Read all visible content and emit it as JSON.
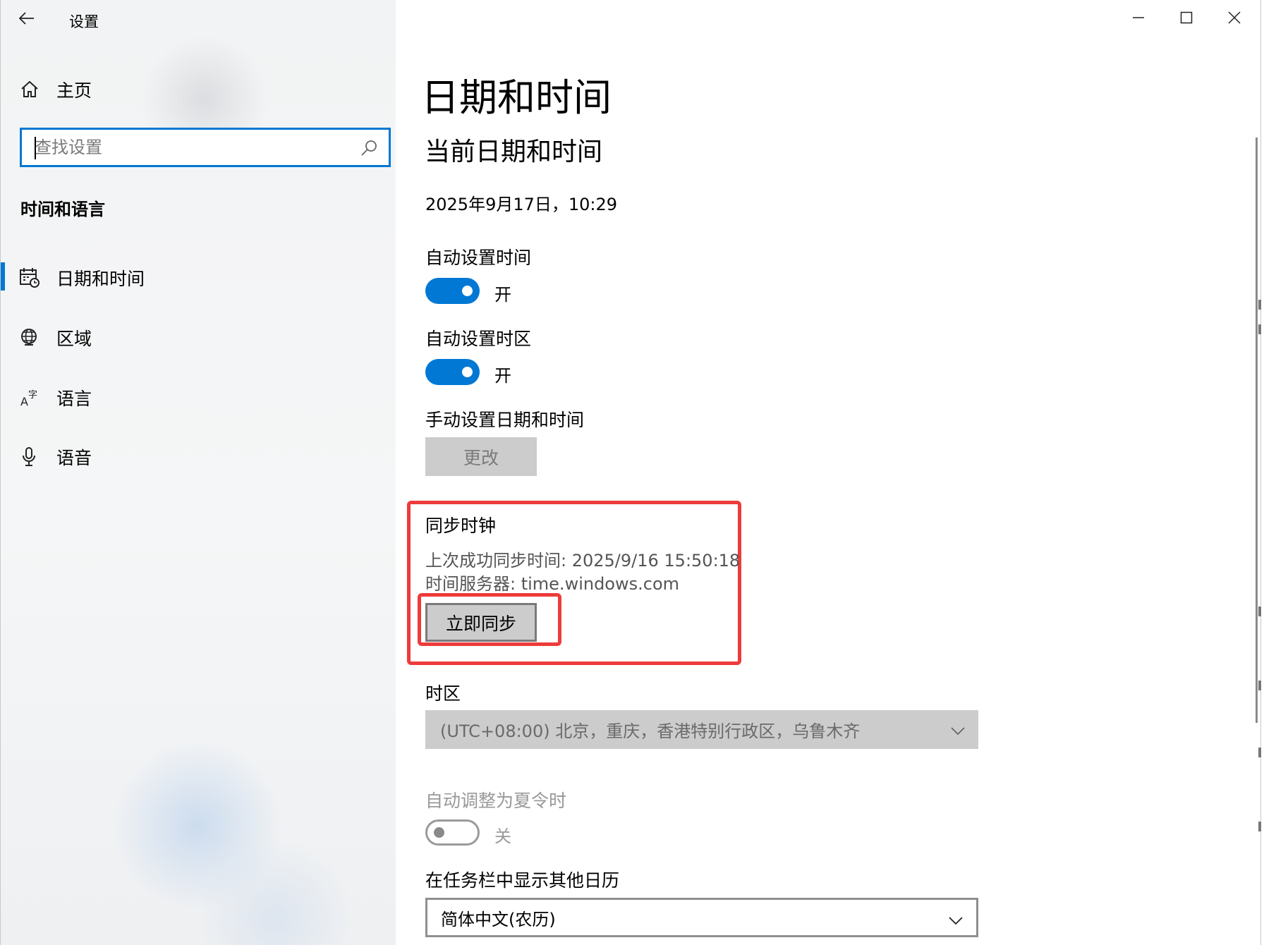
{
  "window": {
    "title": "设置",
    "controls": {
      "minimize_icon": "minimize-icon",
      "maximize_icon": "maximize-icon",
      "close_icon": "close-icon"
    }
  },
  "sidebar": {
    "home_label": "主页",
    "search": {
      "placeholder": "查找设置",
      "value": ""
    },
    "section_title": "时间和语言",
    "items": [
      {
        "label": "日期和时间",
        "icon": "calendar-clock-icon",
        "active": true
      },
      {
        "label": "区域",
        "icon": "globe-icon",
        "active": false
      },
      {
        "label": "语言",
        "icon": "language-icon",
        "active": false
      },
      {
        "label": "语音",
        "icon": "microphone-icon",
        "active": false
      }
    ]
  },
  "main": {
    "page_title": "日期和时间",
    "subtitle": "当前日期和时间",
    "current_datetime": "2025年9月17日，10:29",
    "auto_time": {
      "label": "自动设置时间",
      "state": "开",
      "on": true
    },
    "auto_timezone": {
      "label": "自动设置时区",
      "state": "开",
      "on": true
    },
    "manual": {
      "label": "手动设置日期和时间",
      "button": "更改",
      "enabled": false
    },
    "sync": {
      "title": "同步时钟",
      "last_sync": "上次成功同步时间: 2025/9/16 15:50:18",
      "server": "时间服务器: time.windows.com",
      "button": "立即同步",
      "annotation_color": "#ee3b3b"
    },
    "timezone": {
      "label": "时区",
      "value": "(UTC+08:00) 北京，重庆，香港特别行政区，乌鲁木齐",
      "enabled": false
    },
    "dst": {
      "label": "自动调整为夏令时",
      "state": "关",
      "on": false,
      "enabled": false
    },
    "calendar": {
      "label": "在任务栏中显示其他日历",
      "value": "简体中文(农历)"
    }
  },
  "colors": {
    "accent": "#0078d4",
    "highlight": "#ee3b3b",
    "button_bg": "#cccccc"
  }
}
